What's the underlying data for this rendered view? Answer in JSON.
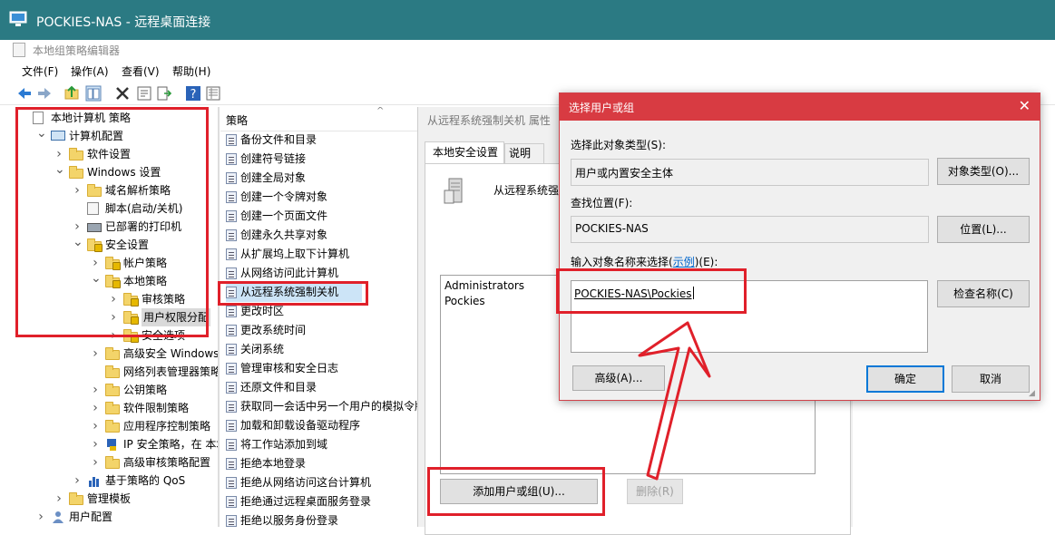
{
  "rd_window": {
    "title": "POCKIES-NAS - 远程桌面连接"
  },
  "gpedit": {
    "title": "本地组策略编辑器",
    "menu": [
      "文件(F)",
      "操作(A)",
      "查看(V)",
      "帮助(H)"
    ]
  },
  "tree": {
    "items": [
      {
        "label": "本地计算机 策略",
        "icon": "policy-doc-icon",
        "depth": 0,
        "chevron": "none"
      },
      {
        "label": "计算机配置",
        "icon": "computer-icon",
        "depth": 1,
        "chevron": "open"
      },
      {
        "label": "软件设置",
        "icon": "folder-icon",
        "depth": 2,
        "chevron": "closed"
      },
      {
        "label": "Windows 设置",
        "icon": "folder-icon",
        "depth": 2,
        "chevron": "open"
      },
      {
        "label": "域名解析策略",
        "icon": "folder-icon",
        "depth": 3,
        "chevron": "closed"
      },
      {
        "label": "脚本(启动/关机)",
        "icon": "script-icon",
        "depth": 3,
        "chevron": "none"
      },
      {
        "label": "已部署的打印机",
        "icon": "printer-icon",
        "depth": 3,
        "chevron": "closed"
      },
      {
        "label": "安全设置",
        "icon": "security-folder-icon",
        "depth": 3,
        "chevron": "open"
      },
      {
        "label": "帐户策略",
        "icon": "security-folder-icon",
        "depth": 4,
        "chevron": "closed"
      },
      {
        "label": "本地策略",
        "icon": "security-folder-icon",
        "depth": 4,
        "chevron": "open"
      },
      {
        "label": "审核策略",
        "icon": "security-folder-icon",
        "depth": 5,
        "chevron": "closed"
      },
      {
        "label": "用户权限分配",
        "icon": "security-folder-icon",
        "depth": 5,
        "chevron": "closed",
        "selected": true
      },
      {
        "label": "安全选项",
        "icon": "security-folder-icon",
        "depth": 5,
        "chevron": "closed"
      },
      {
        "label": "高级安全 Windows De",
        "icon": "folder-icon",
        "depth": 4,
        "chevron": "closed"
      },
      {
        "label": "网络列表管理器策略",
        "icon": "folder-icon",
        "depth": 4,
        "chevron": "none"
      },
      {
        "label": "公钥策略",
        "icon": "folder-icon",
        "depth": 4,
        "chevron": "closed"
      },
      {
        "label": "软件限制策略",
        "icon": "folder-icon",
        "depth": 4,
        "chevron": "closed"
      },
      {
        "label": "应用程序控制策略",
        "icon": "folder-icon",
        "depth": 4,
        "chevron": "closed"
      },
      {
        "label": "IP 安全策略，在 本地计",
        "icon": "ipsec-icon",
        "depth": 4,
        "chevron": "closed"
      },
      {
        "label": "高级审核策略配置",
        "icon": "folder-icon",
        "depth": 4,
        "chevron": "closed"
      },
      {
        "label": "基于策略的 QoS",
        "icon": "qos-chart-icon",
        "depth": 3,
        "chevron": "closed"
      },
      {
        "label": "管理模板",
        "icon": "folder-icon",
        "depth": 2,
        "chevron": "closed"
      },
      {
        "label": "用户配置",
        "icon": "user-icon",
        "depth": 1,
        "chevron": "closed"
      }
    ]
  },
  "policies": {
    "header": "策略",
    "items": [
      "备份文件和目录",
      "创建符号链接",
      "创建全局对象",
      "创建一个令牌对象",
      "创建一个页面文件",
      "创建永久共享对象",
      "从扩展坞上取下计算机",
      "从网络访问此计算机",
      "从远程系统强制关机",
      "更改时区",
      "更改系统时间",
      "关闭系统",
      "管理审核和安全日志",
      "还原文件和目录",
      "获取同一会话中另一个用户的模拟令牌",
      "加载和卸载设备驱动程序",
      "将工作站添加到域",
      "拒绝本地登录",
      "拒绝从网络访问这台计算机",
      "拒绝通过远程桌面服务登录",
      "拒绝以服务身份登录"
    ],
    "selected_index": 8
  },
  "properties": {
    "title": "从远程系统强制关机 属性",
    "tabs": [
      "本地安全设置",
      "说明"
    ],
    "policy_name": "从远程系统强制",
    "principals": [
      "Administrators",
      "Pockies"
    ],
    "add_button": "添加用户或组(U)...",
    "remove_button": "删除(R)"
  },
  "dialog": {
    "title": "选择用户或组",
    "object_type_label": "选择此对象类型(S):",
    "object_type_value": "用户或内置安全主体",
    "object_type_button": "对象类型(O)...",
    "location_label": "查找位置(F):",
    "location_value": "POCKIES-NAS",
    "location_button": "位置(L)...",
    "name_label_before": "输入对象名称来选择(",
    "name_label_link": "示例",
    "name_label_after": ")(E):",
    "name_value": "POCKIES-NAS\\Pockies",
    "check_names_button": "检查名称(C)",
    "advanced_button": "高级(A)...",
    "ok_button": "确定",
    "cancel_button": "取消",
    "close_glyph": "✕"
  },
  "colors": {
    "rd_titlebar": "#2b7a83",
    "dialog_titlebar": "#d83b42",
    "annotation_red": "#e0202a",
    "selection": "#cce4f7",
    "link": "#0066cc"
  }
}
